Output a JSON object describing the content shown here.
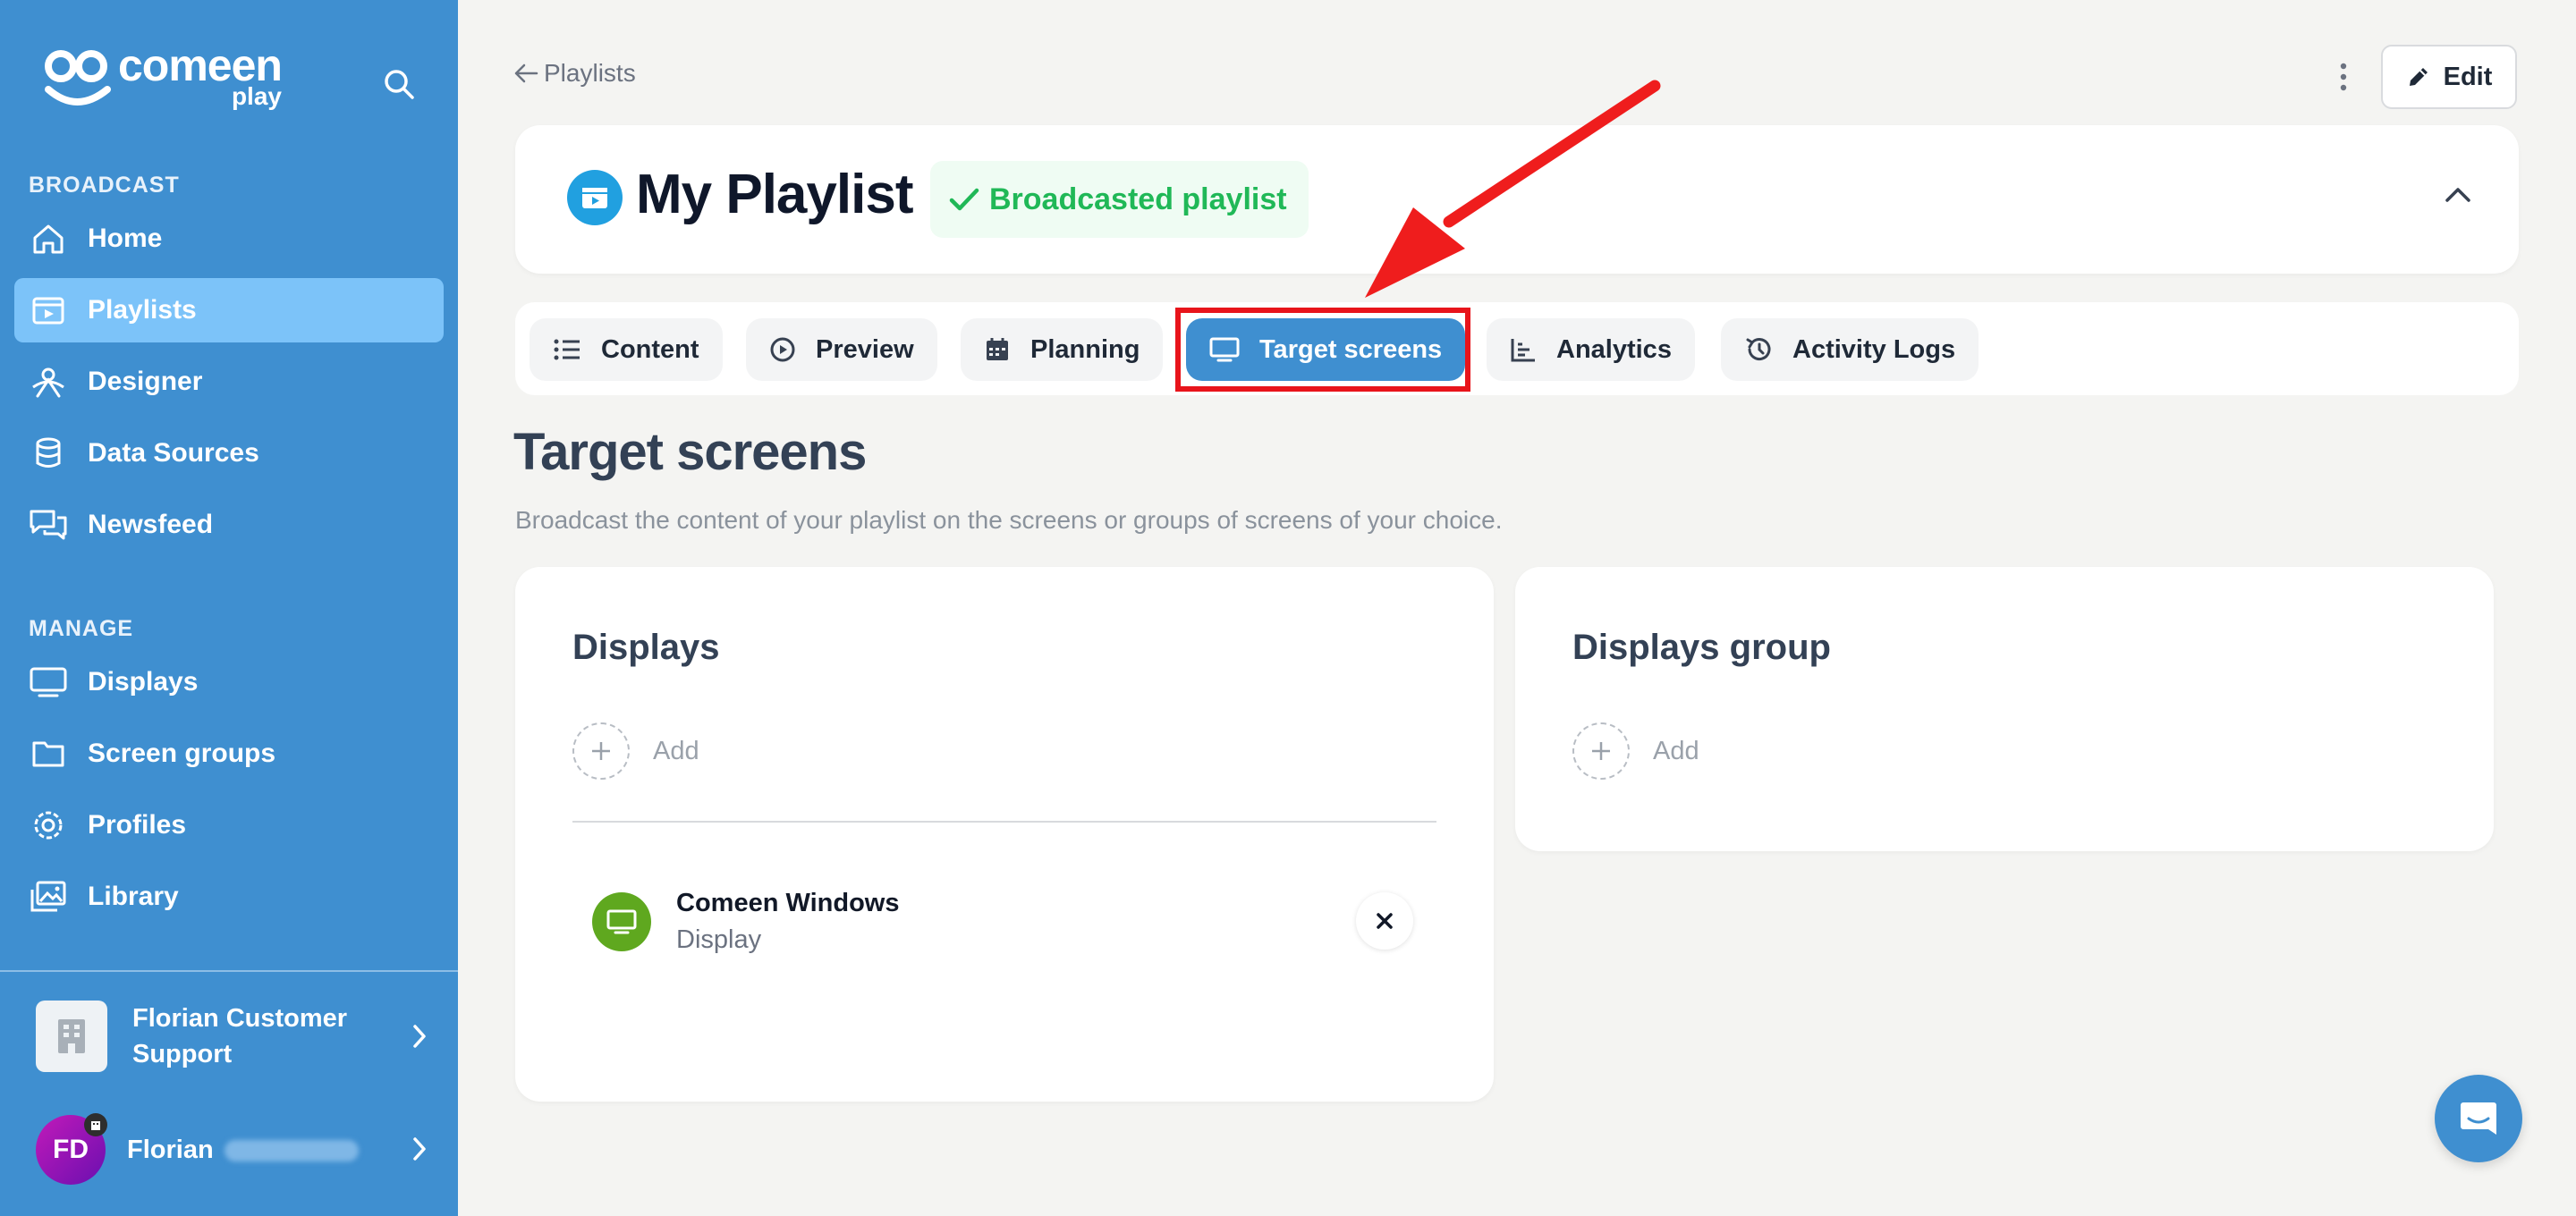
{
  "app": {
    "logo_main": "comeen",
    "logo_sub": "play"
  },
  "sidebar": {
    "sections": [
      {
        "label": "BROADCAST"
      },
      {
        "label": "MANAGE"
      }
    ],
    "items": [
      {
        "label": "Home",
        "icon": "home-icon"
      },
      {
        "label": "Playlists",
        "icon": "playlist-icon",
        "active": true
      },
      {
        "label": "Designer",
        "icon": "designer-icon"
      },
      {
        "label": "Data Sources",
        "icon": "database-icon"
      },
      {
        "label": "Newsfeed",
        "icon": "chat-bubbles-icon"
      },
      {
        "label": "Displays",
        "icon": "monitor-icon"
      },
      {
        "label": "Screen groups",
        "icon": "folder-icon"
      },
      {
        "label": "Profiles",
        "icon": "gear-icon"
      },
      {
        "label": "Library",
        "icon": "images-icon"
      }
    ],
    "org_name": "Florian Customer Support",
    "user_initials": "FD",
    "user_name": "Florian"
  },
  "breadcrumb": {
    "back_label": "Playlists"
  },
  "toolbar": {
    "edit_label": "Edit"
  },
  "playlist": {
    "title": "My Playlist",
    "status": "Broadcasted playlist"
  },
  "tabs": [
    {
      "label": "Content",
      "icon": "list-icon"
    },
    {
      "label": "Preview",
      "icon": "play-circle-icon"
    },
    {
      "label": "Planning",
      "icon": "calendar-icon"
    },
    {
      "label": "Target screens",
      "icon": "monitor-icon",
      "active": true
    },
    {
      "label": "Analytics",
      "icon": "bar-chart-icon"
    },
    {
      "label": "Activity Logs",
      "icon": "history-icon"
    }
  ],
  "page": {
    "title": "Target screens",
    "subtitle": "Broadcast the content of your playlist on the screens or groups of screens of your choice."
  },
  "displays_card": {
    "title": "Displays",
    "add_label": "Add",
    "items": [
      {
        "name": "Comeen Windows",
        "type": "Display"
      }
    ]
  },
  "groups_card": {
    "title": "Displays group",
    "add_label": "Add"
  },
  "colors": {
    "sidebar": "#3f8fd0",
    "active_item": "#7cc3f9",
    "status_green": "#20b857",
    "highlight_red": "#e8141b"
  }
}
